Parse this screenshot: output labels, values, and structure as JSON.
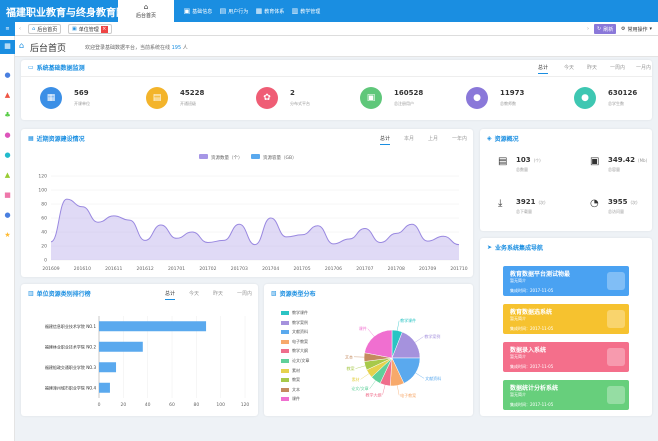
{
  "app": {
    "title": "福建职业教育与终身教育网"
  },
  "topnav": [
    {
      "label": "后台首页",
      "icon": "home-icon"
    },
    {
      "label": "基础信息",
      "icon": "info-icon"
    },
    {
      "label": "用户行为",
      "icon": "user-behavior-icon"
    },
    {
      "label": "教育体系",
      "icon": "education-icon"
    },
    {
      "label": "教学管理",
      "icon": "teaching-icon"
    }
  ],
  "tabs": {
    "home": "后台首页",
    "unit": "单位管理",
    "refresh": "刷新",
    "ops": "常用操作"
  },
  "page": {
    "title": "后台首页",
    "welcome_prefix": "欢迎登录基础数据平台，当前系统在线",
    "online_count": "195",
    "welcome_suffix": "人"
  },
  "filters": [
    "总计",
    "今天",
    "昨天",
    "一周内",
    "一月内"
  ],
  "filters_short": [
    "总计",
    "本月",
    "上月",
    "一年内"
  ],
  "monitor": {
    "title": "系统基础数据监测",
    "stats": [
      {
        "value": "569",
        "label": "开课单位",
        "color": "#3b8fe6"
      },
      {
        "value": "45228",
        "label": "开通班级",
        "color": "#f3b42b"
      },
      {
        "value": "2",
        "label": "分布式平台",
        "color": "#ef5d75"
      },
      {
        "value": "160528",
        "label": "总注册用户",
        "color": "#5fc77a"
      },
      {
        "value": "11973",
        "label": "总教师数",
        "color": "#8a78d9"
      },
      {
        "value": "630126",
        "label": "总学生数",
        "color": "#3ec7b2"
      }
    ]
  },
  "resource_build": {
    "title": "近期资源建设情况"
  },
  "chart_data": [
    {
      "type": "area",
      "series": [
        {
          "name": "资源数量（个）",
          "color": "#a696e6"
        },
        {
          "name": "资源容量（GB）",
          "color": "#5aa9ee"
        }
      ],
      "x": [
        "201609",
        "201610",
        "201611",
        "201612",
        "201701",
        "201702",
        "201703",
        "201704",
        "201705",
        "201706",
        "201707",
        "201708",
        "201709",
        "201710"
      ],
      "values": [
        26,
        87,
        76,
        54,
        63,
        57,
        28,
        50,
        31,
        40,
        25,
        28,
        51,
        22,
        60,
        33,
        36,
        49,
        23,
        30,
        45,
        25,
        38,
        51,
        27,
        34,
        22
      ],
      "ylim": [
        0,
        120
      ],
      "yticks": [
        0,
        20,
        40,
        60,
        80,
        100,
        120
      ]
    },
    {
      "type": "bar",
      "orientation": "horizontal",
      "categories": [
        "福建信息职业技术学院 NO.1",
        "福建林业职业技术学院 NO.2",
        "福建船政交通职业学院 NO.3",
        "福建漳州城市职业学院 NO.4"
      ],
      "values": [
        88,
        36,
        14,
        9
      ],
      "xticks": [
        0,
        20,
        40,
        60,
        80,
        100,
        120
      ],
      "xlim": [
        0,
        120
      ]
    },
    {
      "type": "pie",
      "categories": [
        "教学课件",
        "教学案例",
        "文献资料",
        "电子教案",
        "教学大纲",
        "论文/文章",
        "素材",
        "教案",
        "文本",
        "课件"
      ],
      "values": [
        6,
        19,
        18,
        8,
        6,
        6,
        5,
        5,
        5,
        22
      ],
      "colors": [
        "#2bc4c4",
        "#a592dd",
        "#5aa9ee",
        "#f7a96b",
        "#ef6e8c",
        "#5fd09a",
        "#e5d24d",
        "#a7c94a",
        "#c48a5e",
        "#f06fd0"
      ]
    }
  ],
  "resource_overview": {
    "title": "资源概况",
    "items": [
      {
        "value": "103",
        "unit": "(个)",
        "label": "总数量",
        "icon": "inbox-icon"
      },
      {
        "value": "349.42",
        "unit": "(Mb)",
        "label": "总容量",
        "icon": "tray-icon"
      },
      {
        "value": "3921",
        "unit": "(次)",
        "label": "总下载量",
        "icon": "download-icon"
      },
      {
        "value": "3955",
        "unit": "(次)",
        "label": "总访问量",
        "icon": "visit-icon"
      }
    ]
  },
  "ranking": {
    "title": "单位资源类别排行榜"
  },
  "distribution": {
    "title": "资源类型分布"
  },
  "systems": {
    "title": "业务系统集成导航",
    "items": [
      {
        "name": "教育数据平台测试物最",
        "desc": "暂无简介",
        "date": "集成时间：2017-11-05",
        "color": "#4aa2f2"
      },
      {
        "name": "教育数据选系统",
        "desc": "暂无简介",
        "date": "集成时间：2017-11-05",
        "color": "#f6c22f"
      },
      {
        "name": "数据录入系统",
        "desc": "暂无简介",
        "date": "集成时间：2017-11-05",
        "color": "#f46f8b"
      },
      {
        "name": "数据统计分析系统",
        "desc": "暂无简介",
        "date": "集成时间：2017-11-05",
        "color": "#67cf7c"
      }
    ]
  }
}
